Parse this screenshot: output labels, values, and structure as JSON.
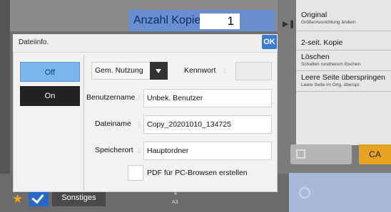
{
  "header": {
    "copies_label": "Anzahl Kopien",
    "copies_value": "1"
  },
  "dialog": {
    "title": "Dateiinfo.",
    "ok_label": "OK",
    "toggle": {
      "off_label": "Off",
      "on_label": "On",
      "selected": "Off"
    },
    "sharing": {
      "selected": "Gem. Nutzung"
    },
    "password": {
      "label": "Kennwort",
      "value": ""
    },
    "fields": {
      "username": {
        "label": "Benutzername",
        "value": "Unbek. Benutzer"
      },
      "filename": {
        "label": "Dateiname",
        "value": "Copy_20201010_134725"
      },
      "location": {
        "label": "Speicherort",
        "value": "Hauptordner"
      }
    },
    "pc_browse_checkbox": {
      "label": "PDF für PC-Browsen erstellen",
      "checked": false
    }
  },
  "right_menu": {
    "items": [
      {
        "main": "Original",
        "sub": "Größe/Ausrichtung ändern"
      },
      {
        "main": "2-seit. Kopie",
        "sub": ""
      },
      {
        "main": "Löschen",
        "sub": "Schatten rundherum löschen"
      },
      {
        "main": "Leere Seite überspringen",
        "sub": "Leere Seite im Orig. überspr."
      }
    ],
    "ca_label": "CA"
  },
  "bottom": {
    "others_label": "Sonstiges",
    "paper_size": "A3",
    "tray_number": "4"
  },
  "colors": {
    "accent": "#3a7bd5",
    "off_selected": "#7bb5ee",
    "ca": "#e6a31f",
    "favorite_star": "#f1a419"
  },
  "icons": [
    "star-icon",
    "checkmark-icon",
    "play-arrow-icon"
  ]
}
